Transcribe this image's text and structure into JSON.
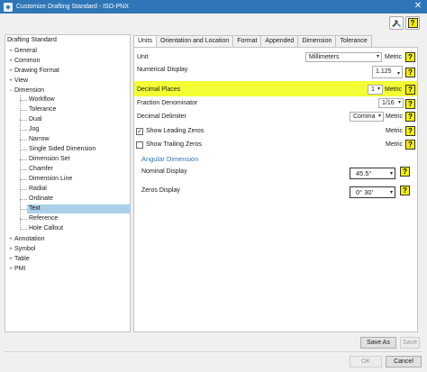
{
  "window": {
    "title": "Customize Drafting Standard - ISO-PNX",
    "close_glyph": "✕"
  },
  "toolbar": {
    "tool_icon": "wrench-load-icon",
    "help_icon": "help-icon",
    "help_glyph": "?"
  },
  "tree": {
    "root": "Drafting Standard",
    "top_level": [
      {
        "label": "General",
        "expander": "+"
      },
      {
        "label": "Common",
        "expander": "+"
      },
      {
        "label": "Drawing Format",
        "expander": "+"
      },
      {
        "label": "View",
        "expander": "+"
      },
      {
        "label": "Dimension",
        "expander": "−"
      }
    ],
    "dimension_children": [
      "Workflow",
      "Tolerance",
      "Dual",
      "Jog",
      "Narrow",
      "Single Sided Dimension",
      "Dimension Set",
      "Chamfer",
      "Dimension Line",
      "Radial",
      "Ordinate",
      "Text",
      "Reference",
      "Hole Callout"
    ],
    "selected": "Text",
    "bottom_level": [
      {
        "label": "Annotation",
        "expander": "+"
      },
      {
        "label": "Symbol",
        "expander": "+"
      },
      {
        "label": "Table",
        "expander": "+"
      },
      {
        "label": "PMI",
        "expander": "+"
      }
    ]
  },
  "tabs": [
    "Units",
    "Orientation and Location",
    "Format",
    "Appended",
    "Dimension",
    "Tolerance"
  ],
  "active_tab": "Units",
  "units": {
    "unit_label": "Unit",
    "unit_value": "Millimeters",
    "numerical_display_label": "Numerical Display",
    "numerical_display_value": "1.125",
    "decimal_places_label": "Decimal Places",
    "decimal_places_value": "1",
    "fraction_denominator_label": "Fraction Denominator",
    "fraction_denominator_value": "1/16",
    "decimal_delimiter_label": "Decimal Delimiter",
    "decimal_delimiter_value": "Comma",
    "show_leading_zeros_label": "Show Leading Zeros",
    "show_leading_zeros_checked": true,
    "show_trailing_zeros_label": "Show Trailing Zeros",
    "show_trailing_zeros_checked": false,
    "metric_label": "Metric",
    "caret": "▾",
    "check_glyph": "✓"
  },
  "angular": {
    "section_title": "Angular Dimension",
    "nominal_display_label": "Nominal Display",
    "nominal_display_value": "45.5°",
    "zeros_display_label": "Zeros Display",
    "zeros_display_value": "0° 30′"
  },
  "buttons": {
    "save_as": "Save As",
    "save": "Save",
    "ok": "OK",
    "cancel": "Cancel"
  },
  "colors": {
    "highlight": "#f3ff34",
    "selection": "#aad0e9",
    "titlebar": "#2f76b8"
  }
}
